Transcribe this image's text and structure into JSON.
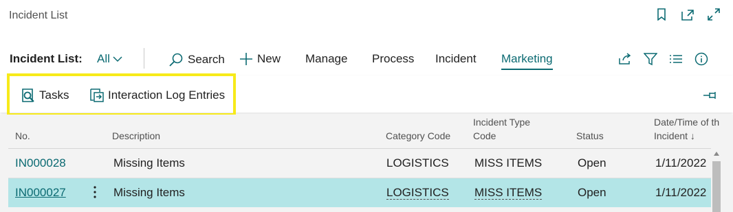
{
  "page": {
    "title": "Incident List"
  },
  "window_icons": [
    "bookmark-icon",
    "open-new-window-icon",
    "expand-icon"
  ],
  "actionbar": {
    "label": "Incident List:",
    "view": "All",
    "items": [
      {
        "label": "Search",
        "icon": "search-icon"
      },
      {
        "label": "New",
        "icon": "plus-icon"
      },
      {
        "label": "Manage"
      },
      {
        "label": "Process"
      },
      {
        "label": "Incident"
      },
      {
        "label": "Marketing",
        "active": true
      }
    ],
    "right_icons": [
      "share-icon",
      "filter-icon",
      "list-view-icon",
      "info-icon"
    ]
  },
  "subactions": [
    {
      "label": "Tasks",
      "icon": "tasks-icon"
    },
    {
      "label": "Interaction Log Entries",
      "icon": "interaction-log-icon"
    }
  ],
  "columns": {
    "no": "No.",
    "description": "Description",
    "category": "Category Code",
    "type_line1": "Incident Type",
    "type_line2": "Code",
    "status": "Status",
    "date_line1": "Date/Time of th",
    "date_line2": "Incident ↓"
  },
  "rows": [
    {
      "no": "IN000028",
      "description": "Missing Items",
      "category": "LOGISTICS",
      "type": "MISS ITEMS",
      "status": "Open",
      "date": "1/11/2022"
    },
    {
      "no": "IN000027",
      "description": "Missing Items",
      "category": "LOGISTICS",
      "type": "MISS ITEMS",
      "status": "Open",
      "date": "1/11/2022"
    }
  ],
  "colors": {
    "accent": "#0b6a72",
    "selected_row": "#b3e5e7",
    "highlight": "#f7ea1a"
  }
}
